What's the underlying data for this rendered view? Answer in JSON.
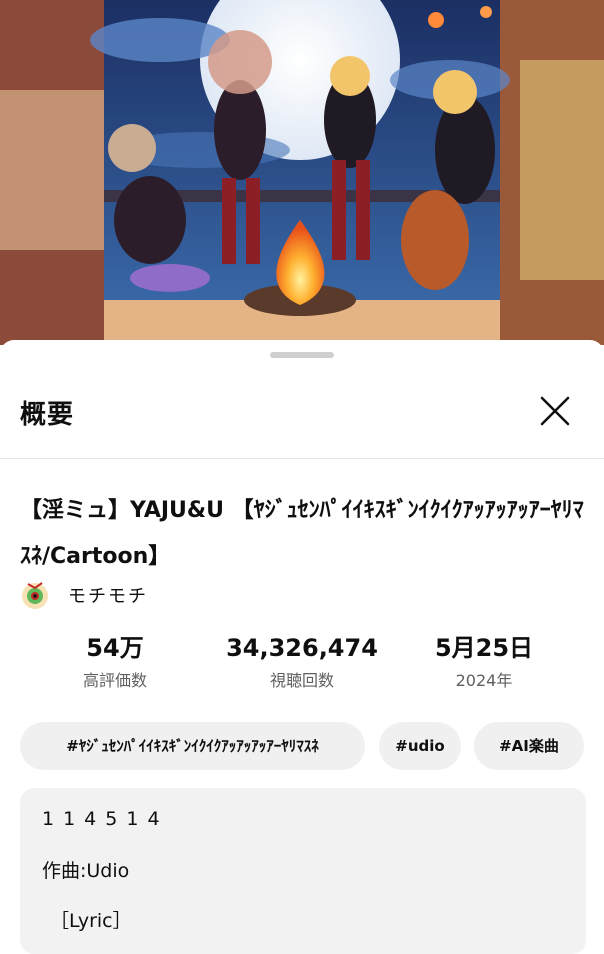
{
  "sheet": {
    "title": "概要",
    "close_icon": "close-icon"
  },
  "video": {
    "title": "【淫ミュ】YAJU&U 【ﾔｼﾞｭｾﾝﾊﾟｲｲｷｽｷﾞﾝｲｸｲｸｱｯｱｯｱｯｱｰﾔﾘﾏｽﾈ/Cartoon】",
    "thumbnail_icon": "cat-band-campfire-illustration"
  },
  "channel": {
    "name": "モチモチ",
    "avatar_icon": "eyeball-avatar-icon"
  },
  "stats": {
    "likes_value": "54万",
    "likes_label": "高評価数",
    "views_value": "34,326,474",
    "views_label": "視聴回数",
    "date_value": "5月25日",
    "date_label": "2024年"
  },
  "tags": [
    "#ﾔｼﾞｭｾﾝﾊﾟｲｲｷｽｷﾞﾝｲｸｲｸｱｯｱｯｱｯｱｰﾔﾘﾏｽﾈ",
    "#udio",
    "#AI楽曲"
  ],
  "description": {
    "lines": [
      "114514",
      "作曲:Udio",
      "［Lyric］"
    ]
  },
  "colors": {
    "background": "#ffffff",
    "chip": "#f0f0f0",
    "description_box": "#f2f2f2",
    "secondary_text": "#606060"
  }
}
